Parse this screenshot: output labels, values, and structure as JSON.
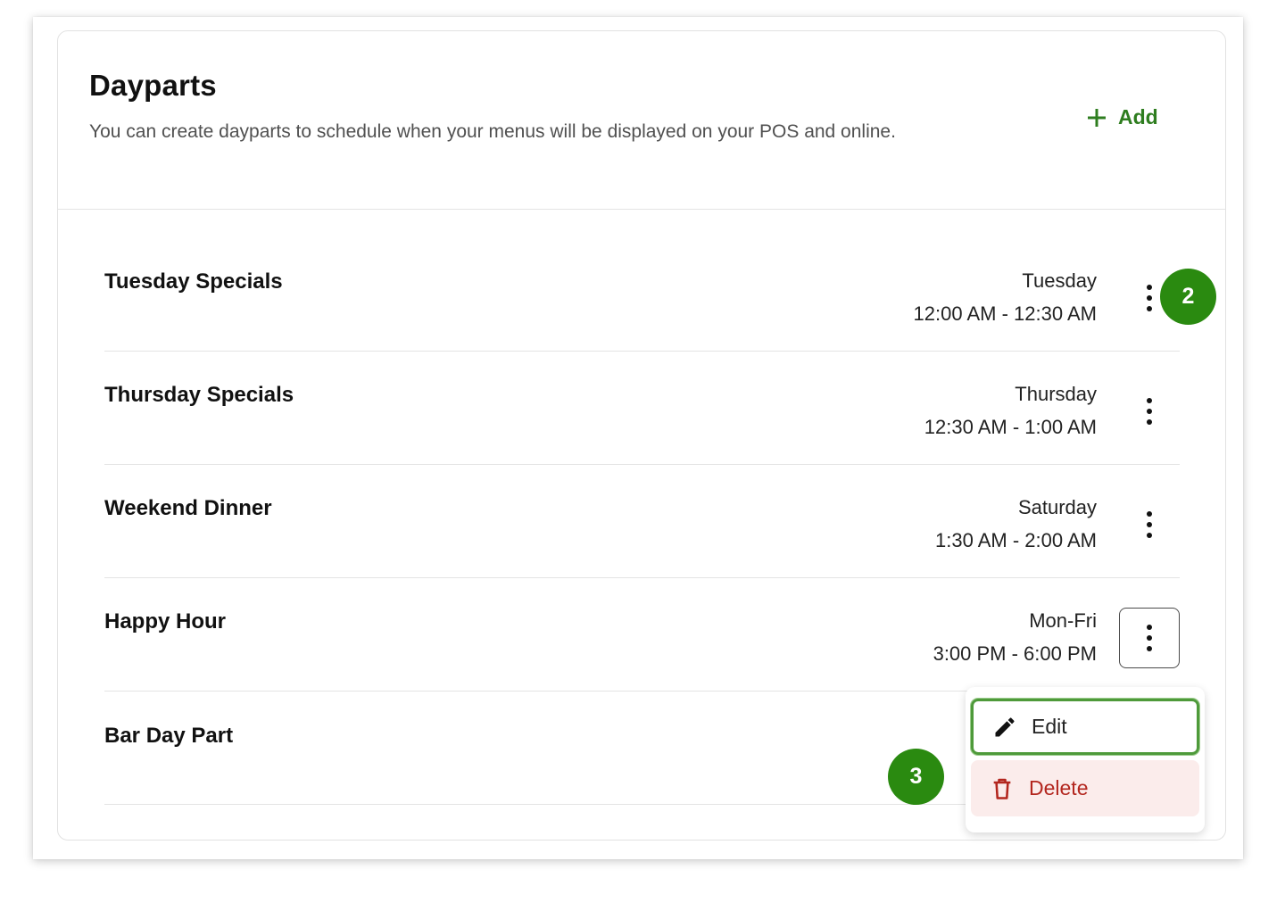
{
  "header": {
    "title": "Dayparts",
    "description": "You can create dayparts to schedule when your menus will be displayed on your POS and online.",
    "add_label": "Add"
  },
  "dayparts": [
    {
      "name": "Tuesday Specials",
      "day": "Tuesday",
      "time": "12:00 AM - 12:30 AM"
    },
    {
      "name": "Thursday Specials",
      "day": "Thursday",
      "time": "12:30 AM - 1:00 AM"
    },
    {
      "name": "Weekend Dinner",
      "day": "Saturday",
      "time": "1:30 AM - 2:00 AM"
    },
    {
      "name": "Happy Hour",
      "day": "Mon-Fri",
      "time": "3:00 PM - 6:00 PM"
    },
    {
      "name": "Bar Day Part",
      "day": "",
      "time": ""
    }
  ],
  "menu": {
    "edit_label": "Edit",
    "delete_label": "Delete"
  },
  "badges": {
    "step_two": "2",
    "step_three": "3"
  },
  "colors": {
    "accent_green": "#2e7d1f",
    "badge_green": "#2a8a10",
    "delete_red": "#b3261e",
    "delete_bg": "#fbeceb"
  },
  "icons": {
    "add": "plus-icon",
    "kebab": "more-vertical-icon",
    "edit": "pencil-icon",
    "delete": "trash-icon"
  }
}
